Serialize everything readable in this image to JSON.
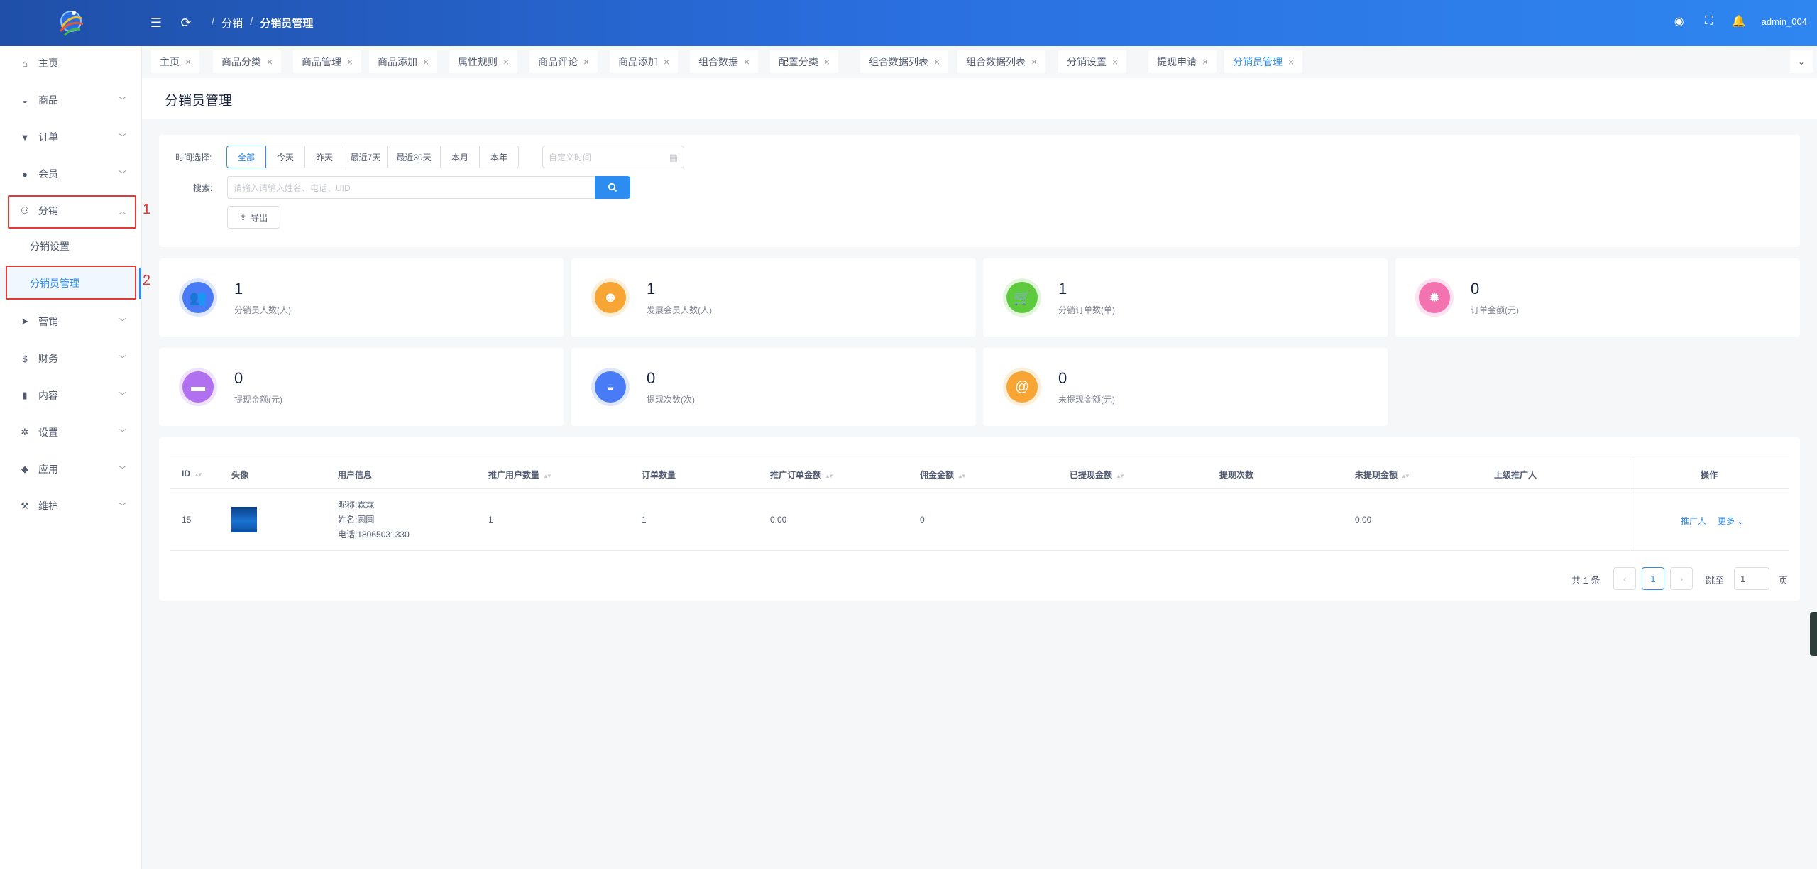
{
  "header": {
    "breadcrumb": [
      "分销",
      "分销员管理"
    ],
    "breadcrumb_sep": "/",
    "user": "admin_004",
    "icons": [
      "menu-fold-icon",
      "refresh-icon",
      "record-icon",
      "fullscreen-icon",
      "bell-icon"
    ]
  },
  "sidebar": {
    "items": [
      {
        "label": "主页",
        "icon": "home-icon",
        "glyph": "⌂",
        "chevron": false
      },
      {
        "label": "商品",
        "icon": "basket-icon",
        "glyph": "◒",
        "chevron": true
      },
      {
        "label": "订单",
        "icon": "cart-icon",
        "glyph": "▼",
        "chevron": true
      },
      {
        "label": "会员",
        "icon": "user-icon",
        "glyph": "●",
        "chevron": true
      },
      {
        "label": "分销",
        "icon": "distribution-icon",
        "glyph": "⚇",
        "chevron": true,
        "open": true
      },
      {
        "label": "营销",
        "icon": "send-icon",
        "glyph": "➤",
        "chevron": true
      },
      {
        "label": "财务",
        "icon": "dollar-icon",
        "glyph": "$",
        "chevron": true
      },
      {
        "label": "内容",
        "icon": "book-icon",
        "glyph": "▮",
        "chevron": true
      },
      {
        "label": "设置",
        "icon": "gear-icon",
        "glyph": "✲",
        "chevron": true
      },
      {
        "label": "应用",
        "icon": "cube-icon",
        "glyph": "◆",
        "chevron": true
      },
      {
        "label": "维护",
        "icon": "hammer-icon",
        "glyph": "⚒",
        "chevron": true
      }
    ],
    "sub_items": [
      {
        "label": "分销设置",
        "active": false
      },
      {
        "label": "分销员管理",
        "active": true
      }
    ],
    "annotations": [
      "1",
      "2"
    ]
  },
  "tabs": [
    {
      "label": "主页"
    },
    {
      "label": "商品分类"
    },
    {
      "label": "商品管理"
    },
    {
      "label": "商品添加"
    },
    {
      "label": "属性规则"
    },
    {
      "label": "商品评论"
    },
    {
      "label": "商品添加"
    },
    {
      "label": "组合数据"
    },
    {
      "label": "配置分类"
    },
    {
      "label": "组合数据列表"
    },
    {
      "label": "组合数据列表"
    },
    {
      "label": "分销设置"
    },
    {
      "label": "提现申请"
    },
    {
      "label": "分销员管理",
      "active": true
    }
  ],
  "page_title": "分销员管理",
  "filter": {
    "time_label": "时间选择:",
    "time_options": [
      "全部",
      "今天",
      "昨天",
      "最近7天",
      "最近30天",
      "本月",
      "本年"
    ],
    "time_selected": "全部",
    "date_placeholder": "自定义时间",
    "search_label": "搜索:",
    "search_placeholder": "请输入请输入姓名、电话、UID",
    "export_label": "导出"
  },
  "stats": [
    {
      "value": "1",
      "label": "分销员人数(人)",
      "icon": "users-icon",
      "color": "#4a7bf7",
      "ring": "#dfe7fd",
      "glyph": "👥"
    },
    {
      "value": "1",
      "label": "发展会员人数(人)",
      "icon": "user-circle-icon",
      "color": "#f7a534",
      "ring": "#fdeed8",
      "glyph": "☻"
    },
    {
      "value": "1",
      "label": "分销订单数(单)",
      "icon": "cart-icon",
      "color": "#5ecb3f",
      "ring": "#e2f6dc",
      "glyph": "🛒"
    },
    {
      "value": "0",
      "label": "订单金额(元)",
      "icon": "bug-icon",
      "color": "#f273b0",
      "ring": "#fde2ef",
      "glyph": "✹"
    },
    {
      "value": "0",
      "label": "提现金额(元)",
      "icon": "trash-icon",
      "color": "#b070f0",
      "ring": "#efe2fc",
      "glyph": "▬"
    },
    {
      "value": "0",
      "label": "提现次数(次)",
      "icon": "basket-icon",
      "color": "#4a7bf7",
      "ring": "#dfe7fd",
      "glyph": "◒"
    },
    {
      "value": "0",
      "label": "未提现金额(元)",
      "icon": "at-icon",
      "color": "#f7a534",
      "ring": "#fdeed8",
      "glyph": "@"
    }
  ],
  "table": {
    "columns": [
      {
        "label": "ID",
        "sortable": true
      },
      {
        "label": "头像",
        "sortable": false
      },
      {
        "label": "用户信息",
        "sortable": false
      },
      {
        "label": "推广用户数量",
        "sortable": true
      },
      {
        "label": "订单数量",
        "sortable": false
      },
      {
        "label": "推广订单金额",
        "sortable": true
      },
      {
        "label": "佣金金额",
        "sortable": true
      },
      {
        "label": "已提现金额",
        "sortable": true
      },
      {
        "label": "提现次数",
        "sortable": false
      },
      {
        "label": "未提现金额",
        "sortable": true
      },
      {
        "label": "上级推广人",
        "sortable": false
      },
      {
        "label": "操作",
        "sortable": false
      }
    ],
    "rows": [
      {
        "id": "15",
        "nickname": "昵称:霖霖",
        "name": "姓名:圆圆",
        "phone": "电话:18065031330",
        "promo_users": "1",
        "orders": "1",
        "promo_amount": "0.00",
        "commission": "0",
        "withdrawn": "",
        "withdraw_count": "",
        "not_withdrawn": "0.00",
        "superior": "",
        "action_promoter": "推广人",
        "action_more": "更多"
      }
    ]
  },
  "pagination": {
    "total": "共 1 条",
    "prev": "‹",
    "current": "1",
    "next": "›",
    "jump_label": "跳至",
    "jump_value": "1",
    "page_unit": "页"
  }
}
